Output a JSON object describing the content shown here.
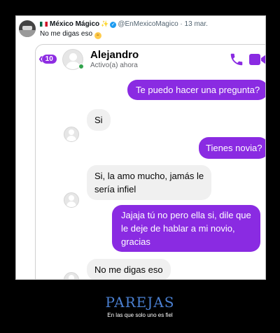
{
  "tweet": {
    "author_name": "México Mágico",
    "handle": "@EnMexicoMagico",
    "date": "13 mar.",
    "text": "No me digas eso",
    "emoji": "😭"
  },
  "chat": {
    "back_count": "10",
    "contact_name": "Alejandro",
    "status": "Activo(a) ahora",
    "accent_color": "#8a2be2",
    "messages": [
      {
        "from": "me",
        "text": "Te puedo hacer una pregunta?"
      },
      {
        "from": "them",
        "text": "Si"
      },
      {
        "from": "me",
        "text": "Tienes novia?"
      },
      {
        "from": "them",
        "lines": [
          "Si, la amo mucho, jamás le",
          "sería infiel"
        ]
      },
      {
        "from": "me",
        "lines": [
          "Jajaja tú no pero ella si, dile que",
          "le deje de hablar a mi novio,",
          "gracias"
        ]
      },
      {
        "from": "them",
        "text": "No me digas eso"
      }
    ]
  },
  "caption": {
    "title": "PAREJAS",
    "subtitle": "En las que solo uno es fiel"
  }
}
